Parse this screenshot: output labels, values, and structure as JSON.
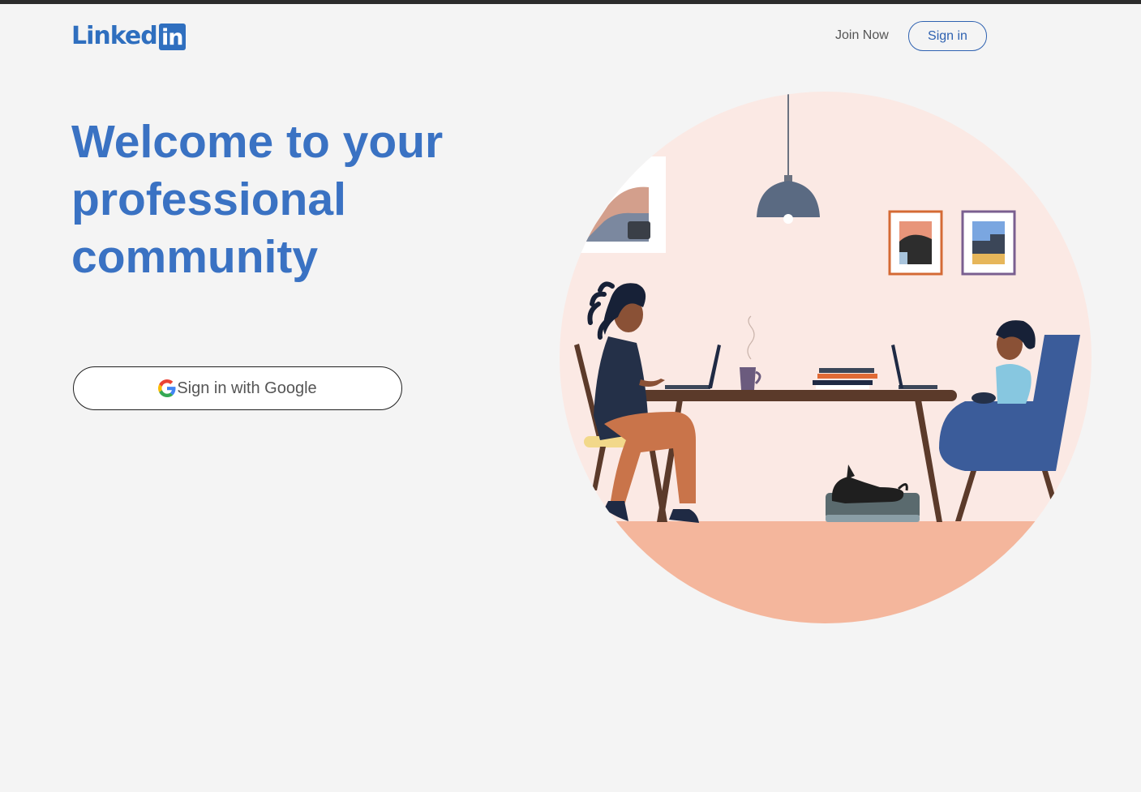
{
  "header": {
    "logo_text": "Linked",
    "logo_box": "in",
    "join_label": "Join Now",
    "signin_label": "Sign in"
  },
  "hero": {
    "headline": "Welcome to your professional community",
    "google_button_label": "Sign in with Google"
  },
  "icons": {
    "google": "google-g-icon"
  },
  "colors": {
    "brand_blue": "#2f6fbf",
    "headline_blue": "#3a72c3",
    "background": "#f4f4f4"
  }
}
